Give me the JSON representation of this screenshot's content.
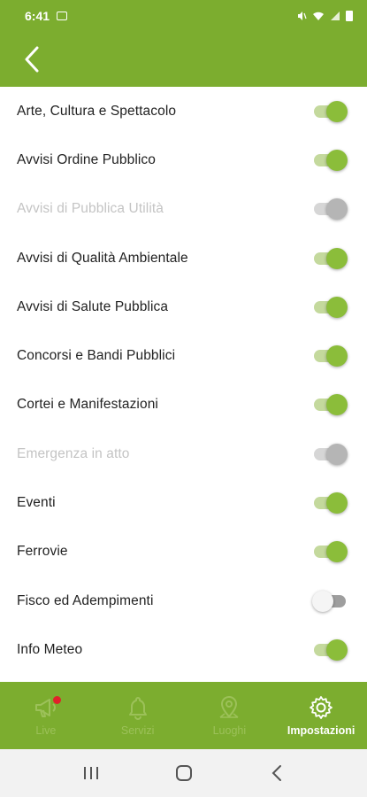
{
  "status_bar": {
    "time": "6:41"
  },
  "settings": [
    {
      "label": "Arte, Cultura e Spettacolo",
      "state": "on"
    },
    {
      "label": "Avvisi Ordine Pubblico",
      "state": "on"
    },
    {
      "label": "Avvisi di Pubblica Utilità",
      "state": "disabled"
    },
    {
      "label": "Avvisi di Qualità Ambientale",
      "state": "on"
    },
    {
      "label": "Avvisi di Salute Pubblica",
      "state": "on"
    },
    {
      "label": "Concorsi e Bandi Pubblici",
      "state": "on"
    },
    {
      "label": "Cortei e Manifestazioni",
      "state": "on"
    },
    {
      "label": "Emergenza in atto",
      "state": "disabled"
    },
    {
      "label": "Eventi",
      "state": "on"
    },
    {
      "label": "Ferrovie",
      "state": "on"
    },
    {
      "label": "Fisco ed Adempimenti",
      "state": "off"
    },
    {
      "label": "Info Meteo",
      "state": "on"
    }
  ],
  "tabs": [
    {
      "label": "Live",
      "icon": "megaphone-icon",
      "badge": true
    },
    {
      "label": "Servizi",
      "icon": "bell-icon"
    },
    {
      "label": "Luoghi",
      "icon": "map-pin-icon"
    },
    {
      "label": "Impostazioni",
      "icon": "gear-icon",
      "active": true
    }
  ],
  "colors": {
    "brand_green": "#7cad2f",
    "toggle_on": "#8bbd3a",
    "badge_red": "#e0222a"
  }
}
